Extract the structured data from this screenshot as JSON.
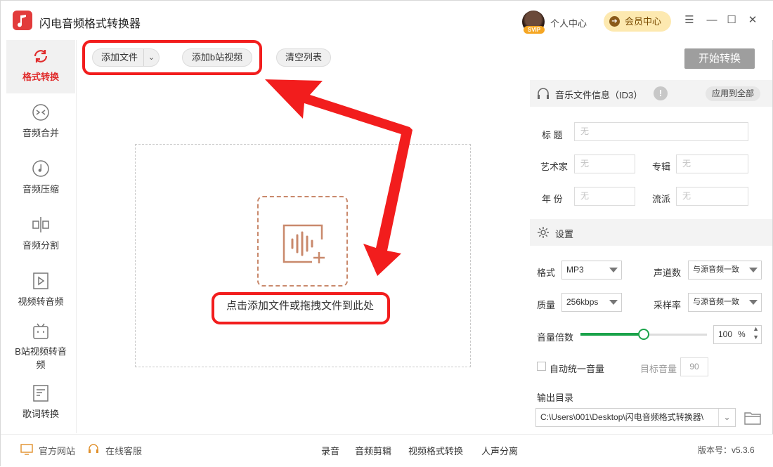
{
  "app": {
    "title": "闪电音频格式转换器"
  },
  "header": {
    "svip_badge": "SVIP",
    "user_center": "个人中心",
    "vip_center": "会员中心"
  },
  "sidebar": {
    "items": [
      {
        "label": "格式转换"
      },
      {
        "label": "音频合并"
      },
      {
        "label": "音频压缩"
      },
      {
        "label": "音频分割"
      },
      {
        "label": "视频转音频"
      },
      {
        "label": "B站视频转音频"
      },
      {
        "label": "歌词转换"
      }
    ]
  },
  "toolbar": {
    "add_file": "添加文件",
    "add_bilibili": "添加b站视频",
    "clear_list": "清空列表",
    "start": "开始转换"
  },
  "dropzone": {
    "hint": "点击添加文件或拖拽文件到此处"
  },
  "id3": {
    "section_title": "音乐文件信息（ID3）",
    "apply_all": "应用到全部",
    "title_label": "标  题",
    "artist_label": "艺术家",
    "album_label": "专辑",
    "year_label": "年  份",
    "genre_label": "流派",
    "placeholder": "无"
  },
  "settings": {
    "section_title": "设置",
    "format_label": "格式",
    "format_value": "MP3",
    "channels_label": "声道数",
    "channels_value": "与源音频一致",
    "quality_label": "质量",
    "quality_value": "256kbps",
    "samplerate_label": "采样率",
    "samplerate_value": "与源音频一致",
    "volume_label": "音量倍数",
    "volume_value": "100",
    "volume_unit": "%",
    "volume_level": 0.5,
    "auto_volume_label": "自动统一音量",
    "target_volume_label": "目标音量",
    "target_volume_value": "90",
    "output_label": "输出目录",
    "output_path": "C:\\Users\\001\\Desktop\\闪电音频格式转换器\\"
  },
  "footer": {
    "website": "官方网站",
    "support": "在线客服",
    "record": "录音",
    "audio_edit": "音频剪辑",
    "video_convert": "视频格式转换",
    "vocal_separate": "人声分离",
    "version": "版本号：v5.3.6"
  },
  "colors": {
    "accent": "#e02b2b",
    "annotation": "#f21d1d",
    "slider": "#1aa34a"
  }
}
